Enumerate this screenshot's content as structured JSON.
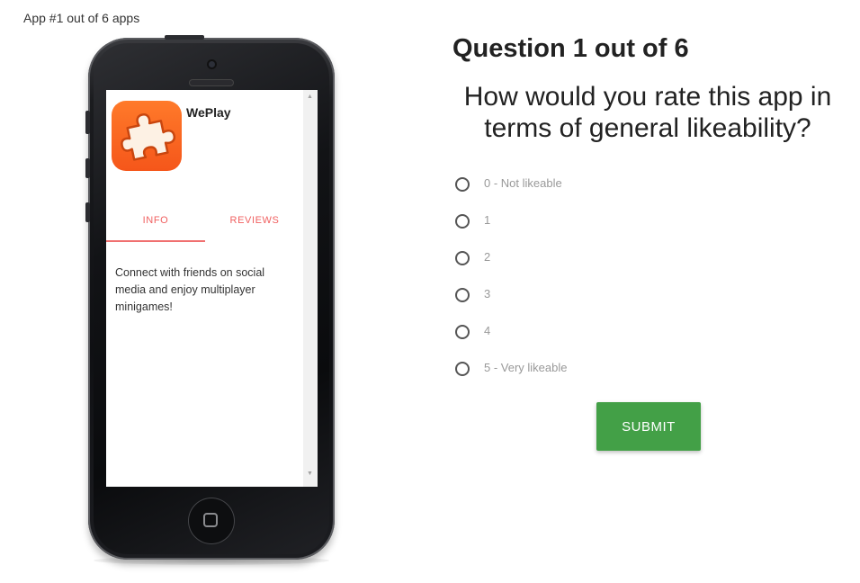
{
  "header": {
    "counter": "App #1 out of 6 apps"
  },
  "app": {
    "name": "WePlay",
    "icon": "puzzle-piece-icon",
    "tabs": [
      {
        "label": "INFO",
        "active": true
      },
      {
        "label": "REVIEWS",
        "active": false
      }
    ],
    "description": "Connect with friends on social media and enjoy multiplayer minigames!"
  },
  "question": {
    "title": "Question 1 out of 6",
    "text": "How would you rate this app in terms of general likeability?",
    "options": [
      {
        "label": "0 - Not likeable",
        "selected": false
      },
      {
        "label": "1",
        "selected": false
      },
      {
        "label": "2",
        "selected": false
      },
      {
        "label": "3",
        "selected": false
      },
      {
        "label": "4",
        "selected": false
      },
      {
        "label": "5 - Very likeable",
        "selected": false
      }
    ],
    "submit_label": "SUBMIT"
  },
  "colors": {
    "submit": "#43a047",
    "tab_accent": "#f06060",
    "icon_orange": "#f5561a"
  }
}
